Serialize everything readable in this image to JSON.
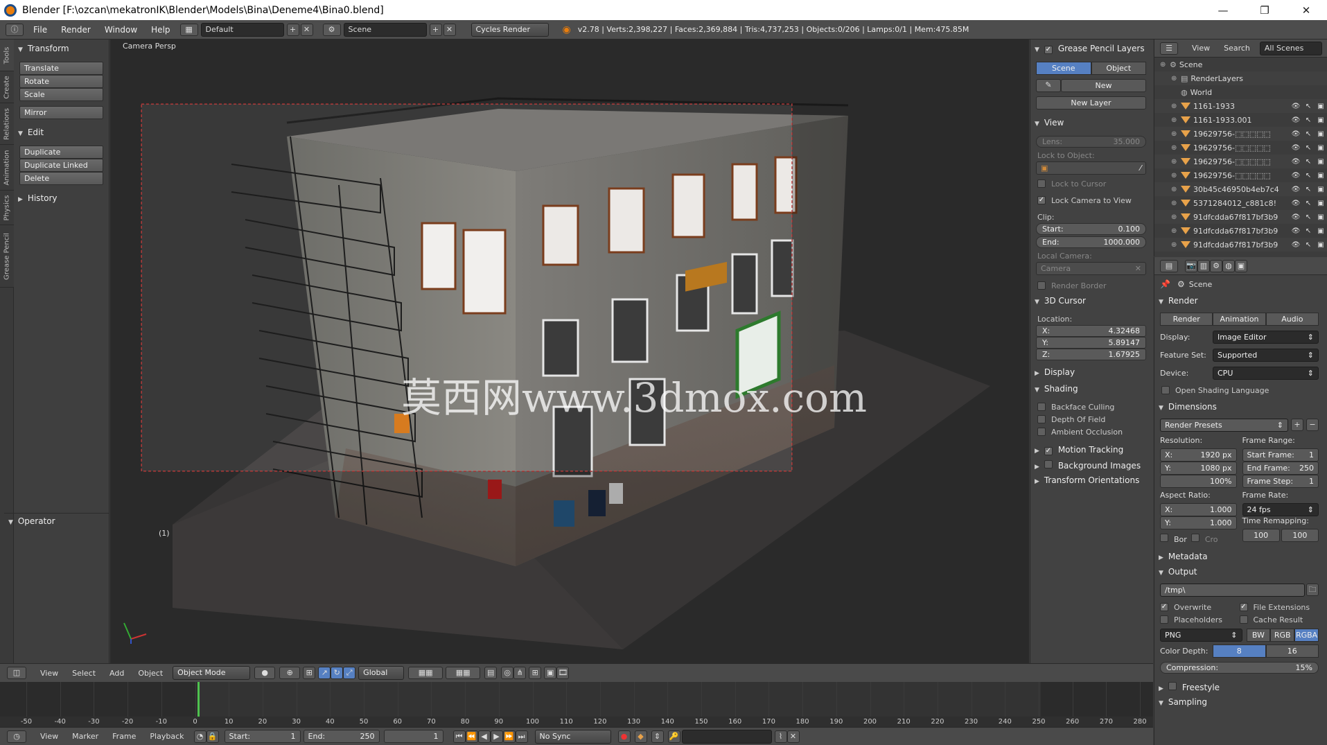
{
  "window": {
    "title": "Blender [F:\\ozcan\\mekatronIK\\Blender\\Models\\Bina\\Deneme4\\Bina0.blend]",
    "controls": [
      "—",
      "❐",
      "✕"
    ]
  },
  "info_header": {
    "menus": [
      "File",
      "Render",
      "Window",
      "Help"
    ],
    "screen_layout": "Default",
    "scene": "Scene",
    "engine": "Cycles Render",
    "stats": "v2.78 | Verts:2,398,227 | Faces:2,369,884 | Tris:4,737,253 | Objects:0/206 | Lamps:0/1 | Mem:475.85M"
  },
  "left_tabs": [
    "Tools",
    "Create",
    "Relations",
    "Animation",
    "Physics",
    "Grease Pencil"
  ],
  "tool_shelf": {
    "transform_header": "Transform",
    "transform_buttons": [
      "Translate",
      "Rotate",
      "Scale",
      "Mirror"
    ],
    "edit_header": "Edit",
    "edit_buttons": [
      "Duplicate",
      "Duplicate Linked",
      "Delete"
    ],
    "history_header": "History",
    "operator_header": "Operator"
  },
  "viewport": {
    "view_label": "Camera Persp",
    "frame_indicator": "(1)",
    "watermark": "莫西网www.3dmox.com"
  },
  "n_panel": {
    "grease_pencil_header": "Grease Pencil Layers",
    "gp_tabs": [
      "Scene",
      "Object"
    ],
    "gp_new": "New",
    "gp_new_layer": "New Layer",
    "view_header": "View",
    "lens_label": "Lens:",
    "lens_value": "35.000",
    "lock_to_object": "Lock to Object:",
    "lock_to_cursor": "Lock to Cursor",
    "lock_camera_to_view": "Lock Camera to View",
    "clip_label": "Clip:",
    "clip_start_label": "Start:",
    "clip_start_value": "0.100",
    "clip_end_label": "End:",
    "clip_end_value": "1000.000",
    "local_camera_label": "Local Camera:",
    "local_camera_value": "Camera",
    "render_border": "Render Border",
    "cursor_header": "3D Cursor",
    "location_label": "Location:",
    "cursor_x_label": "X:",
    "cursor_x": "4.32468",
    "cursor_y_label": "Y:",
    "cursor_y": "5.89147",
    "cursor_z_label": "Z:",
    "cursor_z": "1.67925",
    "display_header": "Display",
    "shading_header": "Shading",
    "shading_options": [
      "Backface Culling",
      "Depth Of Field",
      "Ambient Occlusion"
    ],
    "motion_tracking": "Motion Tracking",
    "background_images": "Background Images",
    "transform_orientations": "Transform Orientations"
  },
  "outliner": {
    "menus": [
      "View",
      "Search",
      "All Scenes"
    ],
    "items": [
      {
        "name": "Scene",
        "kind": "scene"
      },
      {
        "name": "RenderLayers",
        "kind": "layers"
      },
      {
        "name": "World",
        "kind": "world"
      },
      {
        "name": "1161-1933",
        "kind": "mesh"
      },
      {
        "name": "1161-1933.001",
        "kind": "mesh"
      },
      {
        "name": "19629756-⬚⬚⬚⬚⬚",
        "kind": "mesh"
      },
      {
        "name": "19629756-⬚⬚⬚⬚⬚",
        "kind": "mesh"
      },
      {
        "name": "19629756-⬚⬚⬚⬚⬚",
        "kind": "mesh"
      },
      {
        "name": "19629756-⬚⬚⬚⬚⬚",
        "kind": "mesh"
      },
      {
        "name": "30b45c46950b4eb7c4",
        "kind": "mesh"
      },
      {
        "name": "5371284012_c881c8!",
        "kind": "mesh"
      },
      {
        "name": "91dfcdda67f817bf3b9",
        "kind": "mesh"
      },
      {
        "name": "91dfcdda67f817bf3b9",
        "kind": "mesh"
      },
      {
        "name": "91dfcdda67f817bf3b9",
        "kind": "mesh"
      }
    ]
  },
  "properties": {
    "context": "Scene",
    "render_header": "Render",
    "render_buttons": [
      "Render",
      "Animation",
      "Audio"
    ],
    "display_label": "Display:",
    "display_value": "Image Editor",
    "feature_set_label": "Feature Set:",
    "feature_set_value": "Supported",
    "device_label": "Device:",
    "device_value": "CPU",
    "osl": "Open Shading Language",
    "dimensions_header": "Dimensions",
    "render_presets": "Render Presets",
    "resolution_label": "Resolution:",
    "res_x_label": "X:",
    "res_x": "1920 px",
    "res_y_label": "Y:",
    "res_y": "1080 px",
    "res_pct": "100%",
    "frame_range_label": "Frame Range:",
    "start_frame": "Start Frame:",
    "start_frame_value": "1",
    "end_frame": "End Frame:",
    "end_frame_value": "250",
    "frame_step": "Frame Step:",
    "frame_step_value": "1",
    "aspect_label": "Aspect Ratio:",
    "aspect_x_label": "X:",
    "aspect_x": "1.000",
    "aspect_y_label": "Y:",
    "aspect_y": "1.000",
    "frame_rate_label": "Frame Rate:",
    "frame_rate_value": "24 fps",
    "time_remap_label": "Time Remapping:",
    "remap_old": "100",
    "remap_new": "100",
    "bor": "Bor",
    "cro": "Cro",
    "metadata_header": "Metadata",
    "output_header": "Output",
    "output_path": "/tmp\\",
    "overwrite": "Overwrite",
    "file_extensions": "File Extensions",
    "placeholders": "Placeholders",
    "cache_result": "Cache Result",
    "format": "PNG",
    "color_modes": [
      "BW",
      "RGB",
      "RGBA"
    ],
    "color_depth_label": "Color Depth:",
    "color_depths": [
      "8",
      "16"
    ],
    "compression_label": "Compression:",
    "compression_value": "15%",
    "freestyle_header": "Freestyle",
    "sampling_header": "Sampling"
  },
  "view3d_header": {
    "menus": [
      "View",
      "Select",
      "Add",
      "Object"
    ],
    "mode": "Object Mode",
    "orientation": "Global"
  },
  "timeline": {
    "ticks": [
      "-50",
      "-40",
      "-30",
      "-20",
      "-10",
      "0",
      "10",
      "20",
      "30",
      "40",
      "50",
      "60",
      "70",
      "80",
      "90",
      "100",
      "110",
      "120",
      "130",
      "140",
      "150",
      "160",
      "170",
      "180",
      "190",
      "200",
      "210",
      "220",
      "230",
      "240",
      "250",
      "260",
      "270",
      "280"
    ],
    "current_frame": 1,
    "menus": [
      "View",
      "Marker",
      "Frame",
      "Playback"
    ],
    "start_label": "Start:",
    "start_value": "1",
    "end_label": "End:",
    "end_value": "250",
    "frame_value": "1",
    "sync": "No Sync"
  }
}
